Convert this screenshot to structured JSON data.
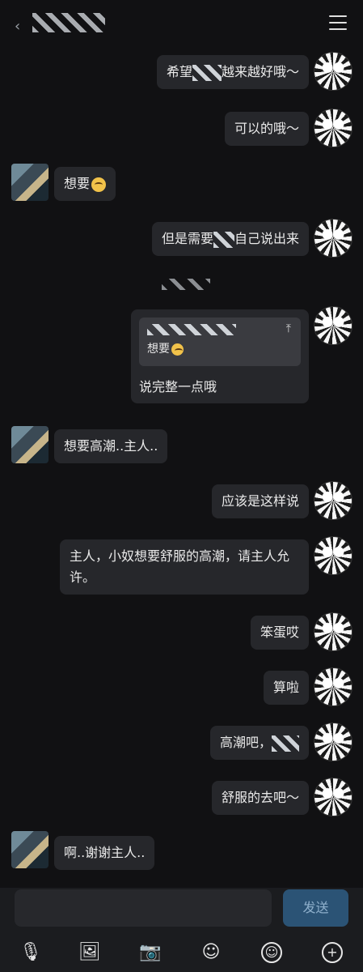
{
  "topbar": {
    "back": "‹",
    "menu_icon": "menu-icon"
  },
  "messages": [
    {
      "side": "right",
      "pre": "希望",
      "post": "越来越好哦～"
    },
    {
      "side": "right",
      "text": "可以的哦～"
    },
    {
      "side": "left",
      "text": "想要"
    },
    {
      "side": "right",
      "pre": "但是需要",
      "post": "自己说出来"
    },
    {
      "side": "right",
      "quote_text": "想要",
      "reply": "说完整一点哦"
    },
    {
      "side": "left",
      "text": "想要高潮..主人.."
    },
    {
      "side": "right",
      "text": "应该是这样说"
    },
    {
      "side": "right",
      "text": "主人，小奴想要舒服的高潮，请主人允许。"
    },
    {
      "side": "right",
      "text": "笨蛋哎"
    },
    {
      "side": "right",
      "text": "算啦"
    },
    {
      "side": "right",
      "pre": "高潮吧，"
    },
    {
      "side": "right",
      "text": "舒服的去吧～"
    },
    {
      "side": "left",
      "text": "啊..谢谢主人.."
    }
  ],
  "composer": {
    "send_label": "发送"
  },
  "tools": {
    "mic": "🎙",
    "image": "🖼",
    "camera": "📷",
    "sticker": "☺",
    "smile": "☺",
    "plus": "+"
  }
}
